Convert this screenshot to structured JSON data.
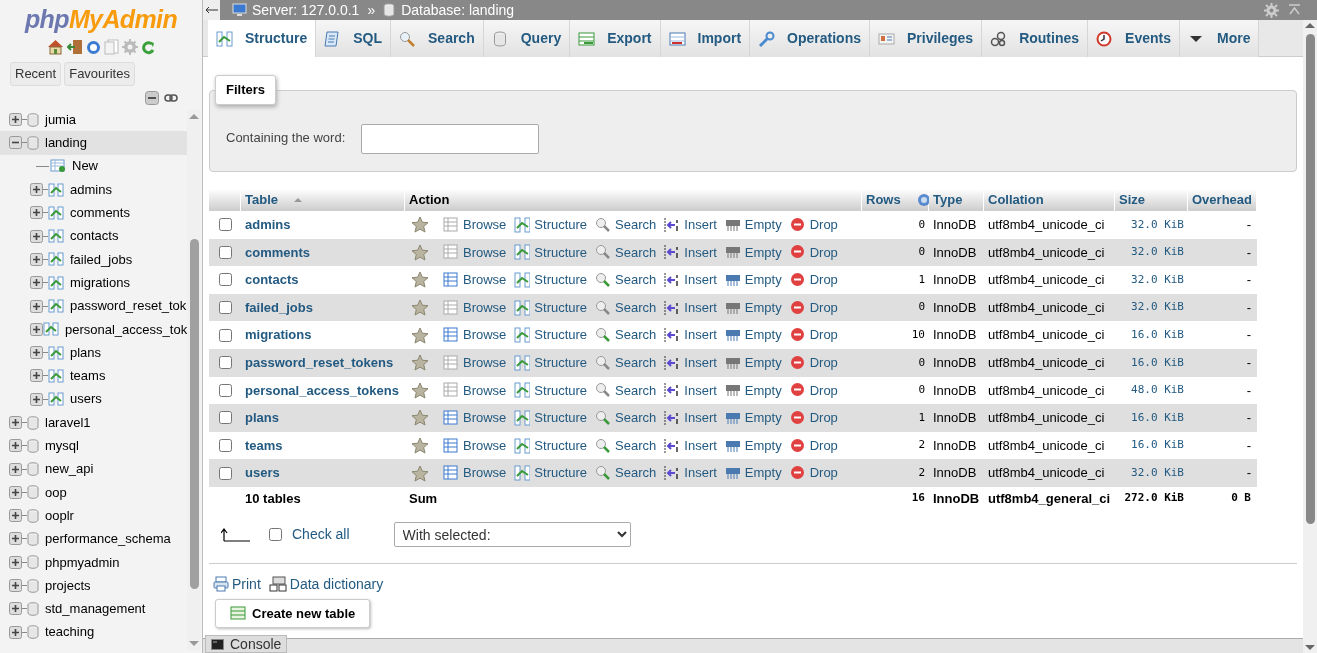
{
  "sidebar": {
    "logo": {
      "php": "php",
      "rest": "MyAdmin"
    },
    "buttons": [
      "Recent",
      "Favourites"
    ],
    "tree": [
      {
        "label": "jumia",
        "kind": "database",
        "expanded": false,
        "selected": false
      },
      {
        "label": "landing",
        "kind": "database",
        "expanded": true,
        "selected": true,
        "children": [
          {
            "label": "New",
            "kind": "new"
          },
          {
            "label": "admins",
            "kind": "table",
            "expanded": false
          },
          {
            "label": "comments",
            "kind": "table",
            "expanded": false
          },
          {
            "label": "contacts",
            "kind": "table",
            "expanded": false
          },
          {
            "label": "failed_jobs",
            "kind": "table",
            "expanded": false
          },
          {
            "label": "migrations",
            "kind": "table",
            "expanded": false
          },
          {
            "label": "password_reset_tok",
            "kind": "table",
            "expanded": false
          },
          {
            "label": "personal_access_tok",
            "kind": "table",
            "expanded": false
          },
          {
            "label": "plans",
            "kind": "table",
            "expanded": false
          },
          {
            "label": "teams",
            "kind": "table",
            "expanded": false
          },
          {
            "label": "users",
            "kind": "table",
            "expanded": false
          }
        ]
      },
      {
        "label": "laravel1",
        "kind": "database",
        "expanded": false,
        "selected": false
      },
      {
        "label": "mysql",
        "kind": "database",
        "expanded": false,
        "selected": false
      },
      {
        "label": "new_api",
        "kind": "database",
        "expanded": false,
        "selected": false
      },
      {
        "label": "oop",
        "kind": "database",
        "expanded": false,
        "selected": false
      },
      {
        "label": "ooplr",
        "kind": "database",
        "expanded": false,
        "selected": false
      },
      {
        "label": "performance_schema",
        "kind": "database",
        "expanded": false,
        "selected": false
      },
      {
        "label": "phpmyadmin",
        "kind": "database",
        "expanded": false,
        "selected": false
      },
      {
        "label": "projects",
        "kind": "database",
        "expanded": false,
        "selected": false
      },
      {
        "label": "std_management",
        "kind": "database",
        "expanded": false,
        "selected": false
      },
      {
        "label": "teaching",
        "kind": "database",
        "expanded": false,
        "selected": false
      }
    ]
  },
  "breadcrumb": {
    "server": "Server: 127.0.0.1",
    "separator": "»",
    "database": "Database: landing"
  },
  "tabs": [
    {
      "label": "Structure",
      "selected": true
    },
    {
      "label": "SQL",
      "selected": false
    },
    {
      "label": "Search",
      "selected": false
    },
    {
      "label": "Query",
      "selected": false
    },
    {
      "label": "Export",
      "selected": false
    },
    {
      "label": "Import",
      "selected": false
    },
    {
      "label": "Operations",
      "selected": false
    },
    {
      "label": "Privileges",
      "selected": false
    },
    {
      "label": "Routines",
      "selected": false
    },
    {
      "label": "Events",
      "selected": false
    },
    {
      "label": "More",
      "selected": false
    }
  ],
  "filters": {
    "title": "Filters",
    "label": "Containing the word:"
  },
  "table": {
    "columns": [
      "Table",
      "Action",
      "Rows",
      "Type",
      "Collation",
      "Size",
      "Overhead"
    ],
    "rows": [
      {
        "name": "admins",
        "checked": false,
        "has_data": false,
        "actions": [
          "Browse",
          "Structure",
          "Search",
          "Insert",
          "Empty",
          "Drop"
        ],
        "rows": "0",
        "type": "InnoDB",
        "collation": "utf8mb4_unicode_ci",
        "size": "32.0 KiB",
        "overhead": "-"
      },
      {
        "name": "comments",
        "checked": false,
        "has_data": false,
        "actions": [
          "Browse",
          "Structure",
          "Search",
          "Insert",
          "Empty",
          "Drop"
        ],
        "rows": "0",
        "type": "InnoDB",
        "collation": "utf8mb4_unicode_ci",
        "size": "32.0 KiB",
        "overhead": "-"
      },
      {
        "name": "contacts",
        "checked": false,
        "has_data": true,
        "actions": [
          "Browse",
          "Structure",
          "Search",
          "Insert",
          "Empty",
          "Drop"
        ],
        "rows": "1",
        "type": "InnoDB",
        "collation": "utf8mb4_unicode_ci",
        "size": "32.0 KiB",
        "overhead": "-"
      },
      {
        "name": "failed_jobs",
        "checked": false,
        "has_data": false,
        "actions": [
          "Browse",
          "Structure",
          "Search",
          "Insert",
          "Empty",
          "Drop"
        ],
        "rows": "0",
        "type": "InnoDB",
        "collation": "utf8mb4_unicode_ci",
        "size": "32.0 KiB",
        "overhead": "-"
      },
      {
        "name": "migrations",
        "checked": false,
        "has_data": true,
        "actions": [
          "Browse",
          "Structure",
          "Search",
          "Insert",
          "Empty",
          "Drop"
        ],
        "rows": "10",
        "type": "InnoDB",
        "collation": "utf8mb4_unicode_ci",
        "size": "16.0 KiB",
        "overhead": "-"
      },
      {
        "name": "password_reset_tokens",
        "checked": false,
        "has_data": false,
        "actions": [
          "Browse",
          "Structure",
          "Search",
          "Insert",
          "Empty",
          "Drop"
        ],
        "rows": "0",
        "type": "InnoDB",
        "collation": "utf8mb4_unicode_ci",
        "size": "16.0 KiB",
        "overhead": "-"
      },
      {
        "name": "personal_access_tokens",
        "checked": false,
        "has_data": false,
        "actions": [
          "Browse",
          "Structure",
          "Search",
          "Insert",
          "Empty",
          "Drop"
        ],
        "rows": "0",
        "type": "InnoDB",
        "collation": "utf8mb4_unicode_ci",
        "size": "48.0 KiB",
        "overhead": "-"
      },
      {
        "name": "plans",
        "checked": false,
        "has_data": true,
        "actions": [
          "Browse",
          "Structure",
          "Search",
          "Insert",
          "Empty",
          "Drop"
        ],
        "rows": "1",
        "type": "InnoDB",
        "collation": "utf8mb4_unicode_ci",
        "size": "16.0 KiB",
        "overhead": "-"
      },
      {
        "name": "teams",
        "checked": false,
        "has_data": true,
        "actions": [
          "Browse",
          "Structure",
          "Search",
          "Insert",
          "Empty",
          "Drop"
        ],
        "rows": "2",
        "type": "InnoDB",
        "collation": "utf8mb4_unicode_ci",
        "size": "16.0 KiB",
        "overhead": "-"
      },
      {
        "name": "users",
        "checked": false,
        "has_data": true,
        "actions": [
          "Browse",
          "Structure",
          "Search",
          "Insert",
          "Empty",
          "Drop"
        ],
        "rows": "2",
        "type": "InnoDB",
        "collation": "utf8mb4_unicode_ci",
        "size": "32.0 KiB",
        "overhead": "-"
      }
    ],
    "footer": {
      "name": "10 tables",
      "action": "Sum",
      "rows": "16",
      "type": "InnoDB",
      "collation": "utf8mb4_general_ci",
      "size": "272.0 KiB",
      "overhead": "0 B"
    }
  },
  "bulk": {
    "check_all": "Check all",
    "checked": false,
    "with_selected": "With selected:"
  },
  "links": [
    "Print",
    "Data dictionary"
  ],
  "create_button": "Create new table",
  "console": "Console"
}
